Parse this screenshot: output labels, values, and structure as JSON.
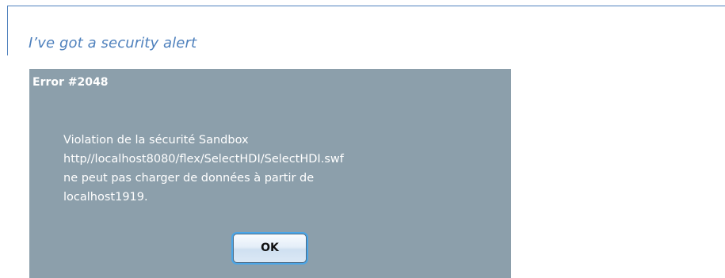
{
  "document": {
    "heading": "I’ve got a security alert"
  },
  "dialog": {
    "title": "Error #2048",
    "message_lines": [
      "Violation de la sécurité Sandbox",
      "http//localhost8080/flex/SelectHDI/SelectHDI.swf",
      "ne peut pas charger de données à partir de",
      "localhost1919."
    ],
    "ok_label": "OK"
  },
  "colors": {
    "heading": "#4f81bd",
    "dialog_background": "#8c9fab",
    "dialog_text": "#ffffff",
    "button_focus": "#4aa6e8"
  }
}
